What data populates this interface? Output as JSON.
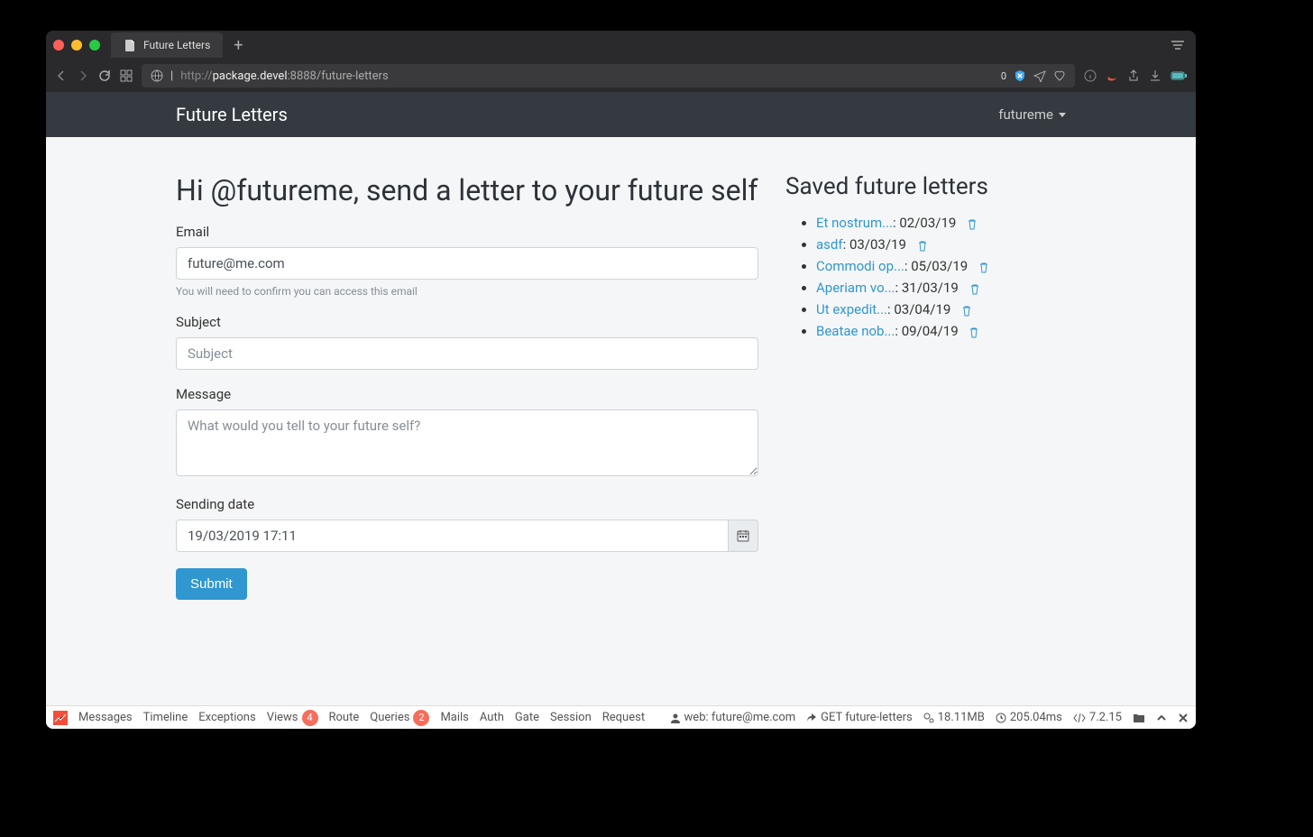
{
  "browser": {
    "tab_title": "Future Letters",
    "url_protocol": "http://",
    "url_host": "package.devel",
    "url_port_path": ":8888/future-letters",
    "blocker_count": "0"
  },
  "navbar": {
    "brand": "Future Letters",
    "username": "futureme"
  },
  "page": {
    "title": "Hi @futureme, send a letter to your future self"
  },
  "form": {
    "email_label": "Email",
    "email_value": "future@me.com",
    "email_help": "You will need to confirm you can access this email",
    "subject_label": "Subject",
    "subject_placeholder": "Subject",
    "message_label": "Message",
    "message_placeholder": "What would you tell to your future self?",
    "sending_date_label": "Sending date",
    "sending_date_value": "19/03/2019 17:11",
    "submit_label": "Submit"
  },
  "saved": {
    "title": "Saved future letters",
    "items": [
      {
        "title": "Et nostrum...",
        "date": "02/03/19"
      },
      {
        "title": "asdf",
        "date": "03/03/19"
      },
      {
        "title": "Commodi op...",
        "date": "05/03/19"
      },
      {
        "title": "Aperiam vo...",
        "date": "31/03/19"
      },
      {
        "title": "Ut expedit...",
        "date": "03/04/19"
      },
      {
        "title": "Beatae nob...",
        "date": "09/04/19"
      }
    ]
  },
  "debugbar": {
    "items": [
      {
        "label": "Messages"
      },
      {
        "label": "Timeline"
      },
      {
        "label": "Exceptions"
      },
      {
        "label": "Views",
        "badge": "4"
      },
      {
        "label": "Route"
      },
      {
        "label": "Queries",
        "badge": "2"
      },
      {
        "label": "Mails"
      },
      {
        "label": "Auth"
      },
      {
        "label": "Gate"
      },
      {
        "label": "Session"
      },
      {
        "label": "Request"
      }
    ],
    "right": {
      "web": "web: future@me.com",
      "route": "GET future-letters",
      "memory": "18.11MB",
      "time": "205.04ms",
      "php": "7.2.15"
    }
  }
}
